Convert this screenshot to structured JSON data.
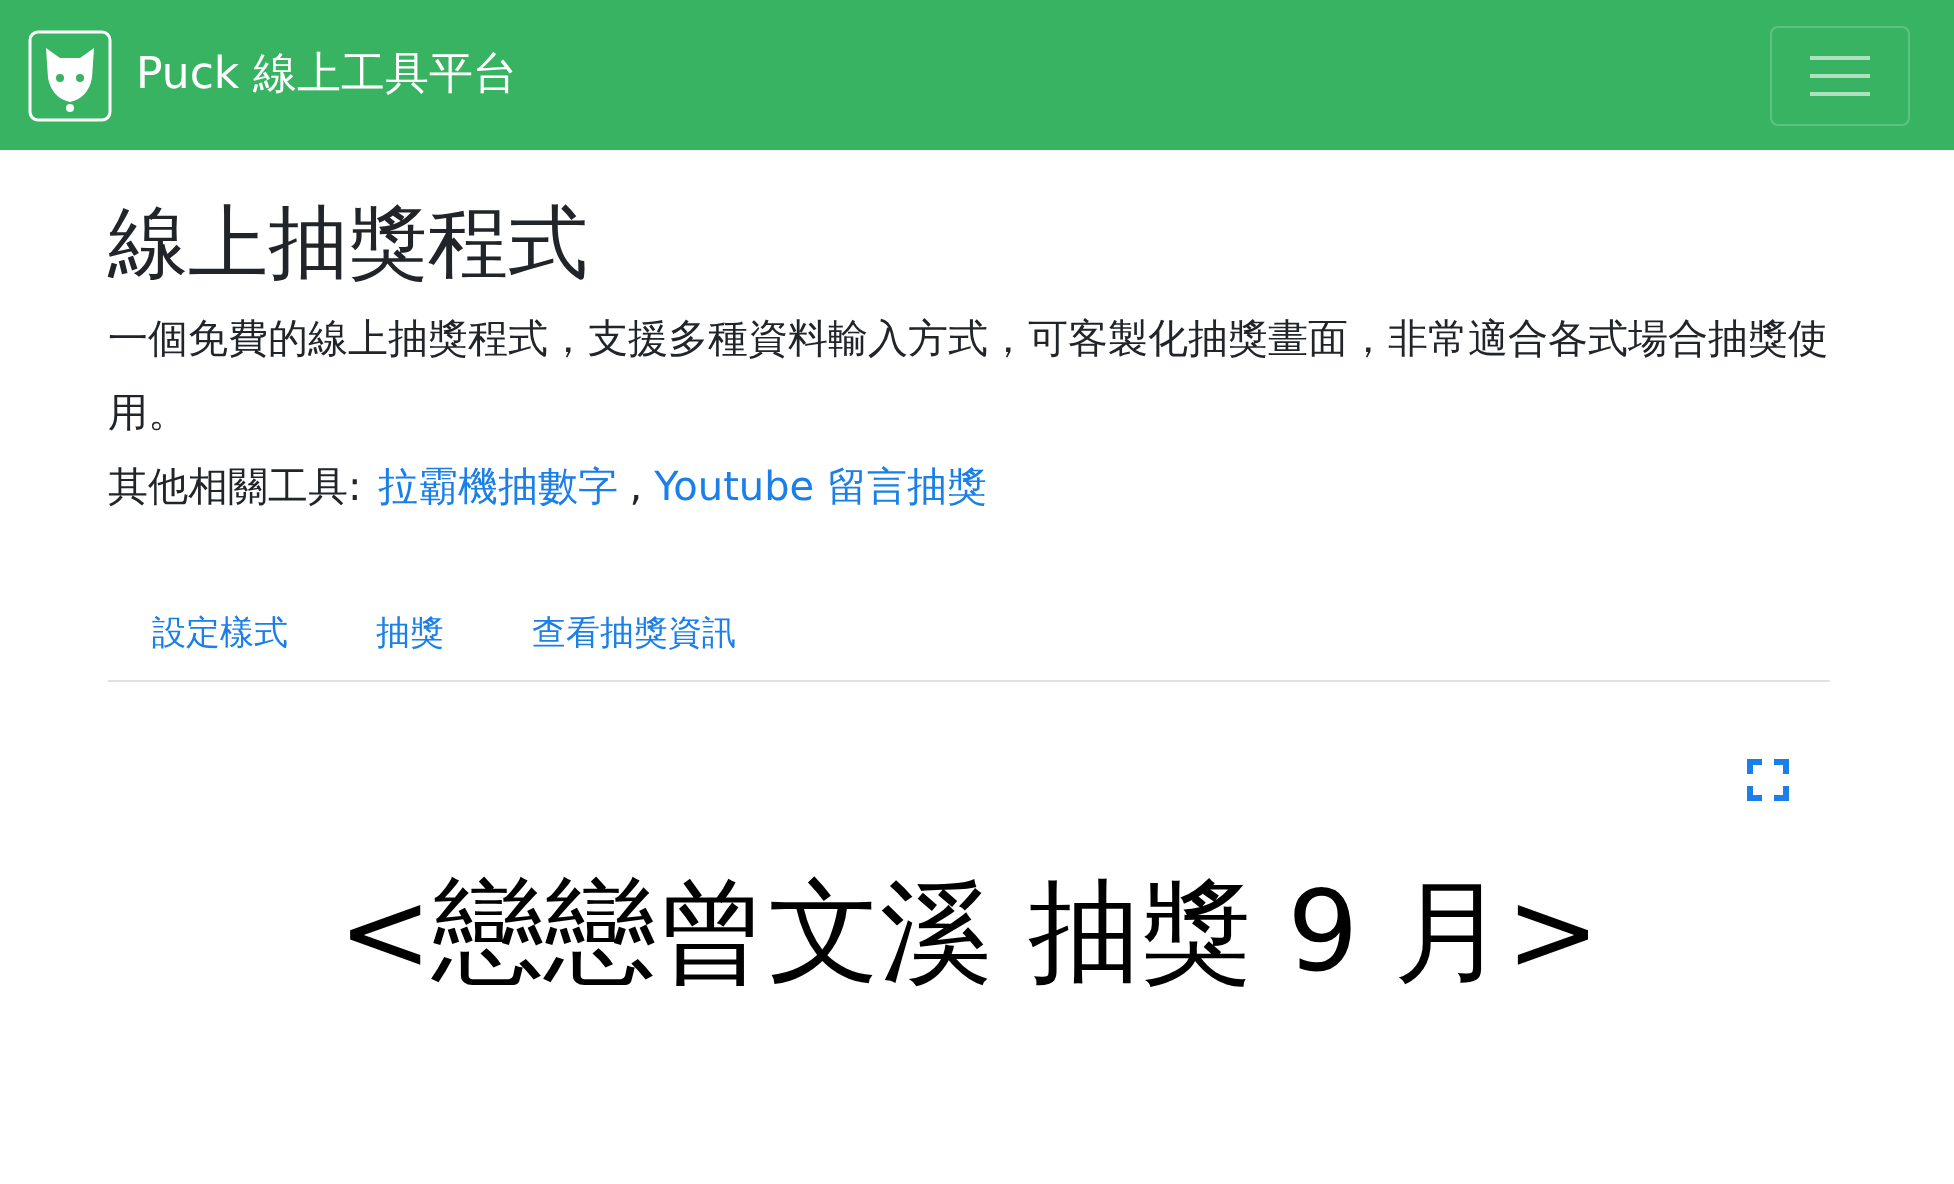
{
  "navbar": {
    "brand": "Puck 線上工具平台"
  },
  "header": {
    "title": "線上抽獎程式",
    "description": "一個免費的線上抽獎程式，支援多種資料輸入方式，可客製化抽獎畫面，非常適合各式場合抽獎使用。",
    "related_label": "其他相關工具:",
    "related_links": [
      "拉霸機抽數字",
      "Youtube 留言抽獎"
    ],
    "separator": ","
  },
  "tabs": [
    {
      "label": "設定樣式",
      "selected": false
    },
    {
      "label": "抽獎",
      "selected": false
    },
    {
      "label": "查看抽獎資訊",
      "selected": false
    }
  ],
  "draw_title": "<戀戀曾文溪 抽獎 9 月>"
}
